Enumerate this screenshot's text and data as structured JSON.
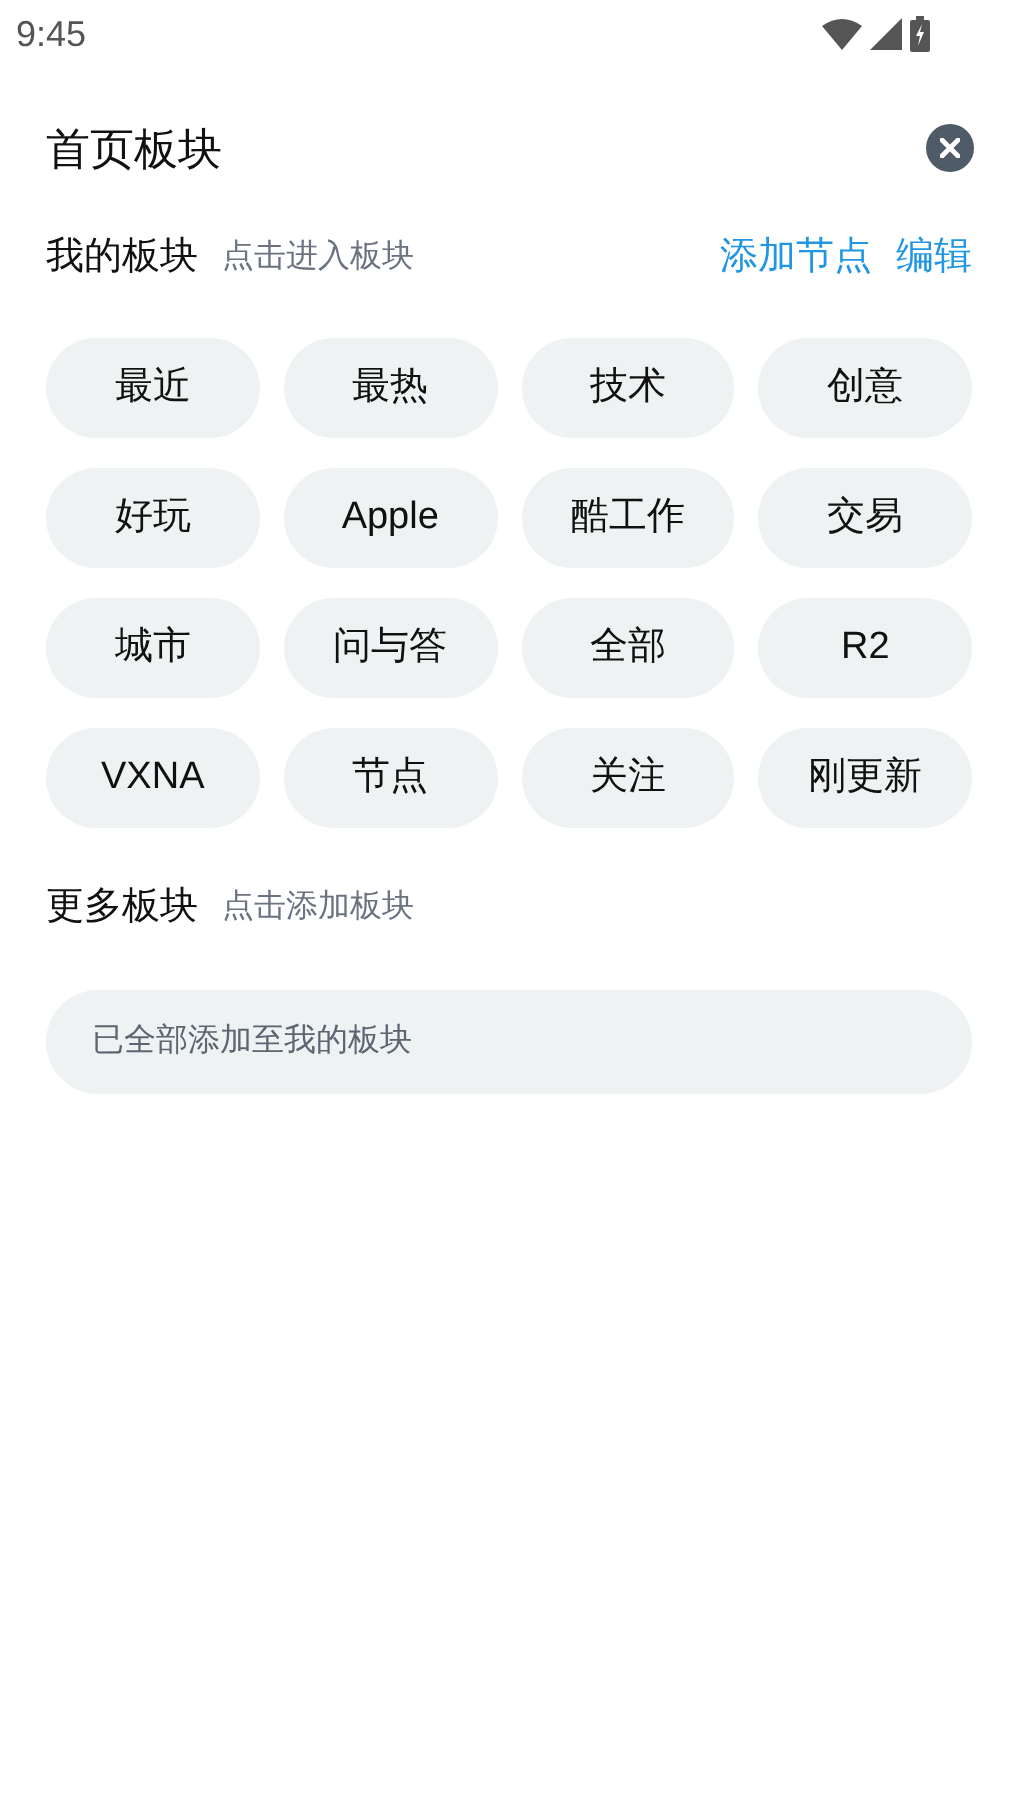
{
  "status_bar": {
    "time": "9:45"
  },
  "header": {
    "title": "首页板块"
  },
  "my_sections": {
    "title": "我的板块",
    "hint": "点击进入板块",
    "actions": [
      "添加节点",
      "编辑"
    ],
    "chips": [
      "最近",
      "最热",
      "技术",
      "创意",
      "好玩",
      "Apple",
      "酷工作",
      "交易",
      "城市",
      "问与答",
      "全部",
      "R2",
      "VXNA",
      "节点",
      "关注",
      "刚更新"
    ]
  },
  "more_sections": {
    "title": "更多板块",
    "hint": "点击添加板块",
    "empty_message": "已全部添加至我的板块"
  }
}
